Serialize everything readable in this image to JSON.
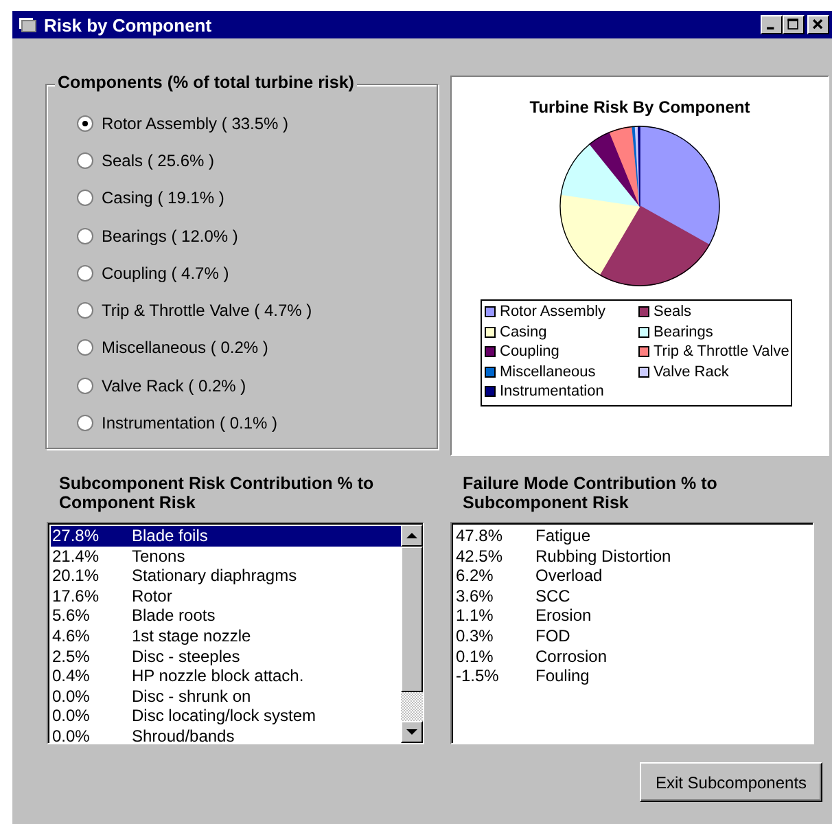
{
  "window": {
    "title": "Risk by Component"
  },
  "components": {
    "title": "Components (% of total turbine risk)",
    "items": [
      {
        "label": "Rotor Assembly ( 33.5% )",
        "selected": true
      },
      {
        "label": "Seals ( 25.6% )",
        "selected": false
      },
      {
        "label": "Casing ( 19.1% )",
        "selected": false
      },
      {
        "label": "Bearings ( 12.0% )",
        "selected": false
      },
      {
        "label": "Coupling ( 4.7% )",
        "selected": false
      },
      {
        "label": "Trip & Throttle Valve ( 4.7% )",
        "selected": false
      },
      {
        "label": "Miscellaneous ( 0.2% )",
        "selected": false
      },
      {
        "label": "Valve Rack ( 0.2% )",
        "selected": false
      },
      {
        "label": "Instrumentation ( 0.1% )",
        "selected": false
      }
    ]
  },
  "chart": {
    "chart_data": {
      "type": "pie",
      "title": "Turbine Risk By Component",
      "categories": [
        "Rotor Assembly",
        "Seals",
        "Casing",
        "Bearings",
        "Coupling",
        "Trip & Throttle Valve",
        "Miscellaneous",
        "Valve Rack",
        "Instrumentation"
      ],
      "values": [
        33.5,
        25.6,
        19.1,
        12.0,
        4.7,
        4.7,
        0.2,
        0.2,
        0.1
      ],
      "colors": [
        "#9999ff",
        "#993366",
        "#ffffcc",
        "#ccffff",
        "#660066",
        "#ff8080",
        "#0066cc",
        "#ccccff",
        "#000080"
      ],
      "legend": "bottom"
    }
  },
  "subcomponents": {
    "title": "Subcomponent Risk Contribution % to Component Risk",
    "rows": [
      {
        "percent": "27.8%",
        "name": "Blade foils",
        "selected": true
      },
      {
        "percent": "21.4%",
        "name": "Tenons",
        "selected": false
      },
      {
        "percent": "20.1%",
        "name": "Stationary diaphragms",
        "selected": false
      },
      {
        "percent": "17.6%",
        "name": "Rotor",
        "selected": false
      },
      {
        "percent": "5.6%",
        "name": "Blade roots",
        "selected": false
      },
      {
        "percent": "4.6%",
        "name": "1st stage nozzle",
        "selected": false
      },
      {
        "percent": "2.5%",
        "name": "Disc - steeples",
        "selected": false
      },
      {
        "percent": "0.4%",
        "name": "HP nozzle block attach.",
        "selected": false
      },
      {
        "percent": "0.0%",
        "name": "Disc - shrunk on",
        "selected": false
      },
      {
        "percent": "0.0%",
        "name": "Disc locating/lock system",
        "selected": false
      },
      {
        "percent": "0.0%",
        "name": "Shroud/bands",
        "selected": false
      }
    ]
  },
  "failure_modes": {
    "title": "Failure Mode Contribution % to Subcomponent Risk",
    "rows": [
      {
        "percent": "47.8%",
        "name": "Fatigue",
        "selected": false
      },
      {
        "percent": "42.5%",
        "name": "Rubbing Distortion",
        "selected": false
      },
      {
        "percent": "6.2%",
        "name": "Overload",
        "selected": false
      },
      {
        "percent": "3.6%",
        "name": "SCC",
        "selected": false
      },
      {
        "percent": "1.1%",
        "name": "Erosion",
        "selected": false
      },
      {
        "percent": "0.3%",
        "name": "FOD",
        "selected": false
      },
      {
        "percent": "0.1%",
        "name": "Corrosion",
        "selected": false
      },
      {
        "percent": "-1.5%",
        "name": "Fouling",
        "selected": false
      }
    ]
  },
  "buttons": [
    "Exit Subcomponents"
  ]
}
